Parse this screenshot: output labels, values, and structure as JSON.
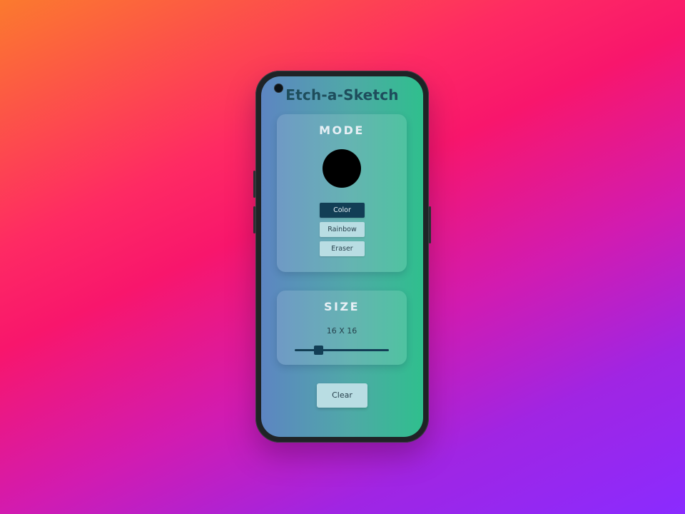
{
  "app": {
    "title": "Etch-a-Sketch"
  },
  "mode": {
    "heading": "MODE",
    "current_color": "#000000",
    "buttons": [
      {
        "label": "Color",
        "active": true
      },
      {
        "label": "Rainbow",
        "active": false
      },
      {
        "label": "Eraser",
        "active": false
      }
    ]
  },
  "size": {
    "heading": "SIZE",
    "display": "16 X 16",
    "value": 16
  },
  "actions": {
    "clear_label": "Clear"
  },
  "colors": {
    "accent": "#123e55",
    "button_light": "#b9dde3",
    "title": "#1e4d5c"
  }
}
